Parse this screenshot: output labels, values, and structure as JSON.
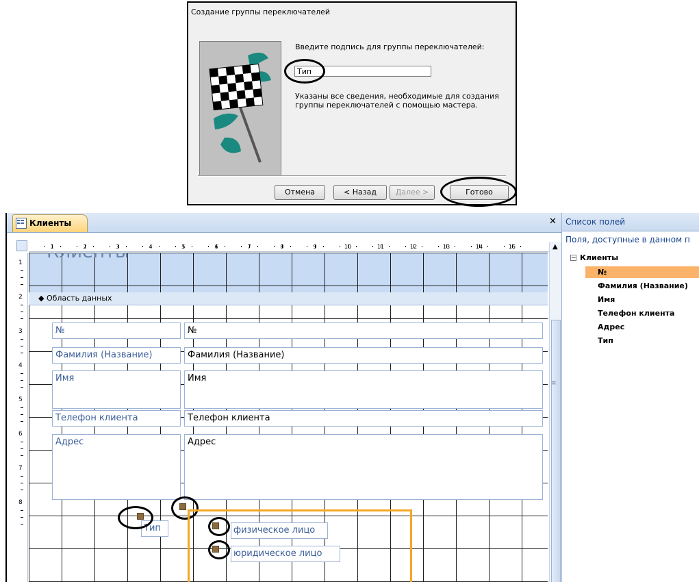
{
  "wizard": {
    "title": "Создание группы переключателей",
    "prompt": "Введите подпись для группы переключателей:",
    "input_value": "Тип",
    "info": "Указаны все сведения, необходимые для создания группы переключателей с помощью мастера.",
    "buttons": {
      "cancel": "Отмена",
      "back": "< Назад",
      "next": "Далее >",
      "finish": "Готово"
    }
  },
  "designer": {
    "tab_label": "Клиенты",
    "close_symbol": "✕",
    "header_title": "Клиенты",
    "section_label": "Область данных",
    "ruler_marks": [
      "1",
      "2",
      "3",
      "4",
      "5",
      "6",
      "7",
      "8",
      "9",
      "10",
      "11",
      "12",
      "13",
      "14",
      "15"
    ],
    "vruler_marks": [
      "1",
      "2",
      "3",
      "4",
      "5",
      "6",
      "7",
      "8"
    ],
    "fields": [
      {
        "label": "№",
        "value": "№"
      },
      {
        "label": "Фамилия (Название)",
        "value": "Фамилия (Название)"
      },
      {
        "label": "Имя",
        "value": "Имя"
      },
      {
        "label": "Телефон клиента",
        "value": "Телефон клиента"
      },
      {
        "label": "Адрес",
        "value": "Адрес"
      }
    ],
    "option_group": {
      "caption": "Тип",
      "options": [
        "физическое лицо",
        "юридическое лицо"
      ]
    }
  },
  "field_list": {
    "title": "Список полей",
    "subtitle": "Поля, доступные в данном п",
    "table": "Клиенты",
    "items": [
      "№",
      "Фамилия (Название)",
      "Имя",
      "Телефон клиента",
      "Адрес",
      "Тип"
    ],
    "selected_index": 0
  },
  "colors": {
    "accent_orange": "#f5a623",
    "label_blue": "#3b5d99",
    "selection": "#fbb36a"
  },
  "icons": [
    "checkered-flag-icon",
    "form-icon",
    "close-icon",
    "chevron-icon",
    "scroll-up-icon",
    "collapse-icon"
  ]
}
